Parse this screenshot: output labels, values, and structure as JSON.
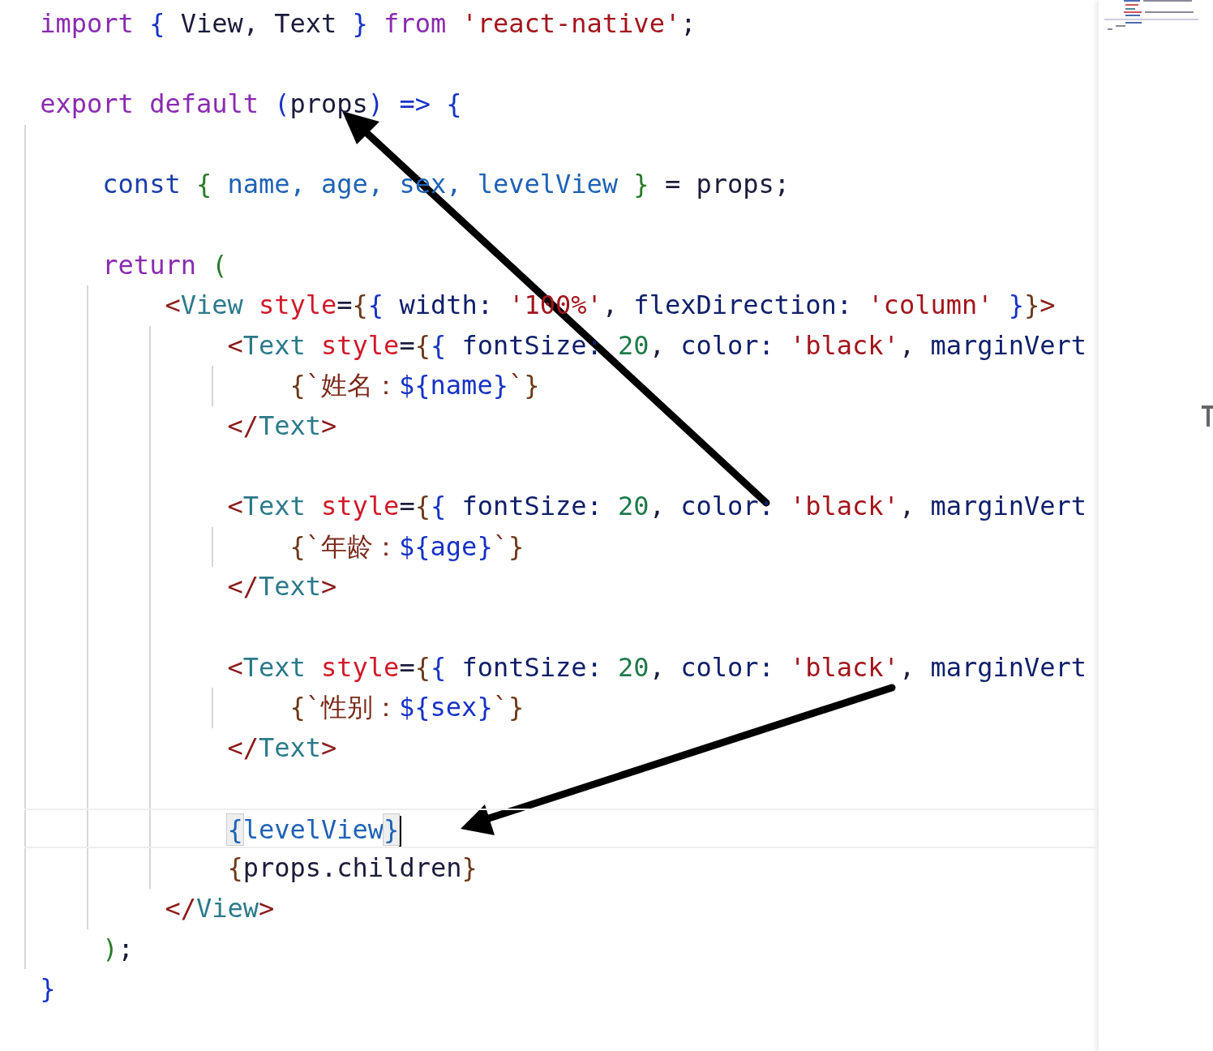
{
  "editor": {
    "lines": [
      {
        "kind": "code",
        "current": false,
        "tokens": [
          {
            "text": "import",
            "kind": "keyword"
          },
          {
            "text": " {",
            "kind": "brace"
          },
          {
            "text": " View, Text ",
            "kind": "plain"
          },
          {
            "text": "}",
            "kind": "brace"
          },
          {
            "text": " from",
            "kind": "keyword"
          },
          {
            "text": " 'react-native'",
            "kind": "string"
          },
          {
            "text": ";",
            "kind": "plain"
          }
        ]
      },
      {
        "kind": "blank",
        "current": false
      },
      {
        "kind": "code",
        "current": false,
        "tokens": [
          {
            "text": "export default",
            "kind": "keyword"
          },
          {
            "text": " (",
            "kind": "brace"
          },
          {
            "text": "props",
            "kind": "plain"
          },
          {
            "text": ") => {",
            "kind": "brace"
          }
        ]
      },
      {
        "kind": "blank",
        "current": false
      },
      {
        "kind": "code",
        "current": false,
        "tokens": [
          {
            "text": "    const",
            "kind": "declare"
          },
          {
            "text": " {",
            "kind": "paren"
          },
          {
            "text": " name, age, sex, levelView ",
            "kind": "binding"
          },
          {
            "text": "}",
            "kind": "paren"
          },
          {
            "text": " = props;",
            "kind": "plain"
          }
        ]
      },
      {
        "kind": "blank",
        "current": false
      },
      {
        "kind": "code",
        "current": false,
        "tokens": [
          {
            "text": "    return",
            "kind": "keyword"
          },
          {
            "text": " (",
            "kind": "paren"
          }
        ]
      },
      {
        "kind": "code",
        "current": false,
        "tokens": [
          {
            "text": "        <",
            "kind": "tag"
          },
          {
            "text": "View",
            "kind": "tagname"
          },
          {
            "text": " style",
            "kind": "attr"
          },
          {
            "text": "=",
            "kind": "plain"
          },
          {
            "text": "{",
            "kind": "brace2"
          },
          {
            "text": "{",
            "kind": "brace"
          },
          {
            "text": " width: ",
            "kind": "prop"
          },
          {
            "text": "'100%'",
            "kind": "string"
          },
          {
            "text": ", ",
            "kind": "plain"
          },
          {
            "text": "flexDirection: ",
            "kind": "prop"
          },
          {
            "text": "'column'",
            "kind": "string"
          },
          {
            "text": " }",
            "kind": "brace"
          },
          {
            "text": "}",
            "kind": "brace2"
          },
          {
            "text": ">",
            "kind": "tag"
          }
        ]
      },
      {
        "kind": "code",
        "current": false,
        "tokens": [
          {
            "text": "            <",
            "kind": "tag"
          },
          {
            "text": "Text",
            "kind": "tagname"
          },
          {
            "text": " style",
            "kind": "attr"
          },
          {
            "text": "=",
            "kind": "plain"
          },
          {
            "text": "{",
            "kind": "brace2"
          },
          {
            "text": "{",
            "kind": "brace"
          },
          {
            "text": " fontSize: ",
            "kind": "prop"
          },
          {
            "text": "20",
            "kind": "number"
          },
          {
            "text": ", ",
            "kind": "plain"
          },
          {
            "text": "color: ",
            "kind": "prop"
          },
          {
            "text": "'black'",
            "kind": "string"
          },
          {
            "text": ", ",
            "kind": "plain"
          },
          {
            "text": "marginVert",
            "kind": "prop"
          }
        ]
      },
      {
        "kind": "code",
        "current": false,
        "tokens": [
          {
            "text": "                {",
            "kind": "brace2"
          },
          {
            "text": "`姓名：",
            "kind": "template"
          },
          {
            "text": "${name}",
            "kind": "interp"
          },
          {
            "text": "`",
            "kind": "template"
          },
          {
            "text": "}",
            "kind": "brace2"
          }
        ]
      },
      {
        "kind": "code",
        "current": false,
        "tokens": [
          {
            "text": "            </",
            "kind": "tag"
          },
          {
            "text": "Text",
            "kind": "tagname"
          },
          {
            "text": ">",
            "kind": "tag"
          }
        ]
      },
      {
        "kind": "blank",
        "current": false
      },
      {
        "kind": "code",
        "current": false,
        "tokens": [
          {
            "text": "            <",
            "kind": "tag"
          },
          {
            "text": "Text",
            "kind": "tagname"
          },
          {
            "text": " style",
            "kind": "attr"
          },
          {
            "text": "=",
            "kind": "plain"
          },
          {
            "text": "{",
            "kind": "brace2"
          },
          {
            "text": "{",
            "kind": "brace"
          },
          {
            "text": " fontSize: ",
            "kind": "prop"
          },
          {
            "text": "20",
            "kind": "number"
          },
          {
            "text": ", ",
            "kind": "plain"
          },
          {
            "text": "color: ",
            "kind": "prop"
          },
          {
            "text": "'black'",
            "kind": "string"
          },
          {
            "text": ", ",
            "kind": "plain"
          },
          {
            "text": "marginVert",
            "kind": "prop"
          }
        ]
      },
      {
        "kind": "code",
        "current": false,
        "tokens": [
          {
            "text": "                {",
            "kind": "brace2"
          },
          {
            "text": "`年龄：",
            "kind": "template"
          },
          {
            "text": "${age}",
            "kind": "interp"
          },
          {
            "text": "`",
            "kind": "template"
          },
          {
            "text": "}",
            "kind": "brace2"
          }
        ]
      },
      {
        "kind": "code",
        "current": false,
        "tokens": [
          {
            "text": "            </",
            "kind": "tag"
          },
          {
            "text": "Text",
            "kind": "tagname"
          },
          {
            "text": ">",
            "kind": "tag"
          }
        ]
      },
      {
        "kind": "blank",
        "current": false
      },
      {
        "kind": "code",
        "current": false,
        "tokens": [
          {
            "text": "            <",
            "kind": "tag"
          },
          {
            "text": "Text",
            "kind": "tagname"
          },
          {
            "text": " style",
            "kind": "attr"
          },
          {
            "text": "=",
            "kind": "plain"
          },
          {
            "text": "{",
            "kind": "brace2"
          },
          {
            "text": "{",
            "kind": "brace"
          },
          {
            "text": " fontSize: ",
            "kind": "prop"
          },
          {
            "text": "20",
            "kind": "number"
          },
          {
            "text": ", ",
            "kind": "plain"
          },
          {
            "text": "color: ",
            "kind": "prop"
          },
          {
            "text": "'black'",
            "kind": "string"
          },
          {
            "text": ", ",
            "kind": "plain"
          },
          {
            "text": "marginVert",
            "kind": "prop"
          }
        ]
      },
      {
        "kind": "code",
        "current": false,
        "tokens": [
          {
            "text": "                {",
            "kind": "brace2"
          },
          {
            "text": "`性别：",
            "kind": "template"
          },
          {
            "text": "${sex}",
            "kind": "interp"
          },
          {
            "text": "`",
            "kind": "template"
          },
          {
            "text": "}",
            "kind": "brace2"
          }
        ]
      },
      {
        "kind": "code",
        "current": false,
        "tokens": [
          {
            "text": "            </",
            "kind": "tag"
          },
          {
            "text": "Text",
            "kind": "tagname"
          },
          {
            "text": ">",
            "kind": "tag"
          }
        ]
      },
      {
        "kind": "blank",
        "current": false
      },
      {
        "kind": "code",
        "current": true,
        "tokens": [
          {
            "text": "            {",
            "kind": "match"
          },
          {
            "text": "levelView",
            "kind": "binding"
          },
          {
            "text": "}",
            "kind": "match"
          }
        ]
      },
      {
        "kind": "code",
        "current": false,
        "tokens": [
          {
            "text": "            {",
            "kind": "brace2"
          },
          {
            "text": "props.children",
            "kind": "plain"
          },
          {
            "text": "}",
            "kind": "brace2"
          }
        ]
      },
      {
        "kind": "code",
        "current": false,
        "tokens": [
          {
            "text": "        </",
            "kind": "tag"
          },
          {
            "text": "View",
            "kind": "tagname"
          },
          {
            "text": ">",
            "kind": "tag"
          }
        ]
      },
      {
        "kind": "code",
        "current": false,
        "tokens": [
          {
            "text": "    )",
            "kind": "paren"
          },
          {
            "text": ";",
            "kind": "plain"
          }
        ]
      },
      {
        "kind": "code",
        "current": false,
        "tokens": [
          {
            "text": "}",
            "kind": "brace"
          }
        ]
      }
    ]
  }
}
